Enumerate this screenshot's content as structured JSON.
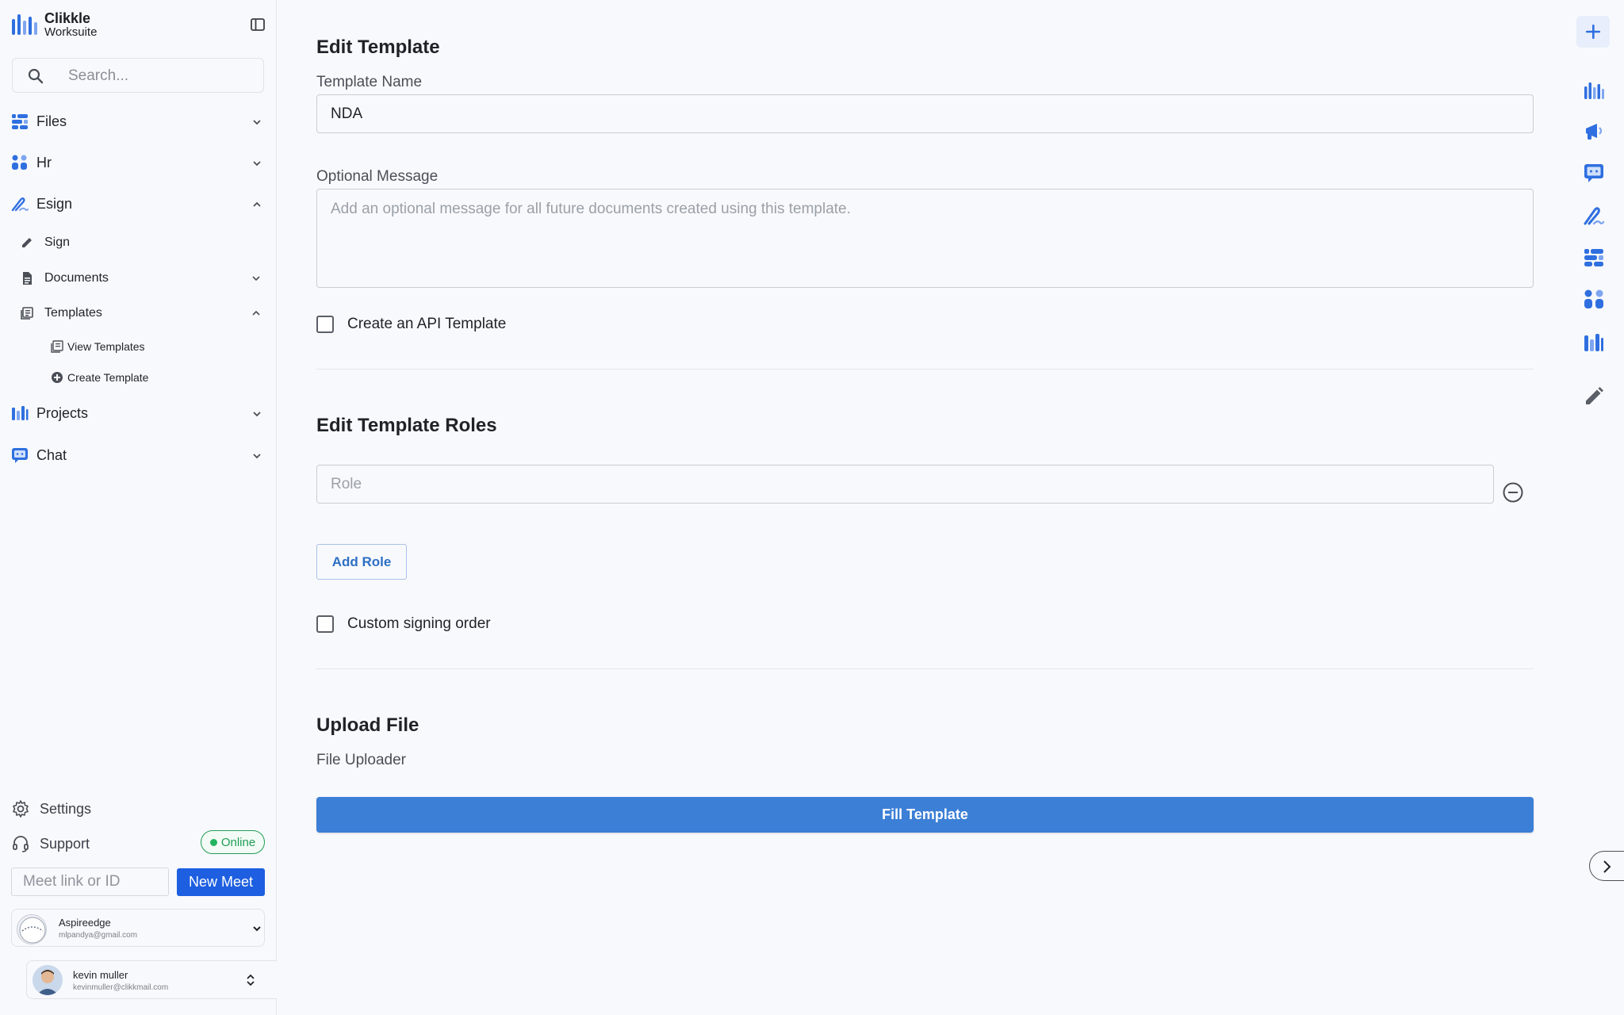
{
  "brand": {
    "line1": "Clikkle",
    "line2": "Worksuite",
    "accent": "#2563eb"
  },
  "search": {
    "placeholder": "Search..."
  },
  "sidebar": {
    "nav": {
      "files": "Files",
      "hr": "Hr",
      "esign": "Esign",
      "sign": "Sign",
      "documents": "Documents",
      "templates": "Templates",
      "view_templates": "View Templates",
      "create_template": "Create Template",
      "projects": "Projects",
      "chat": "Chat"
    },
    "settings": "Settings",
    "support": "Support",
    "status": "Online",
    "meet_placeholder": "Meet link or ID",
    "new_meet": "New Meet",
    "org": {
      "name": "Aspireedge",
      "email": "mlpandya@gmail.com"
    },
    "user": {
      "name": "kevin muller",
      "email": "kevinmuller@clikkmail.com"
    }
  },
  "form": {
    "title": "Edit Template",
    "template_name_label": "Template Name",
    "template_name_value": "NDA",
    "optional_message_label": "Optional Message",
    "optional_message_placeholder": "Add an optional message for all future documents created using this template.",
    "api_template_label": "Create an API Template",
    "roles_title": "Edit Template Roles",
    "role_placeholder": "Role",
    "add_role": "Add Role",
    "custom_order_label": "Custom signing order",
    "upload_title": "Upload File",
    "uploader_label": "File Uploader",
    "fill_button": "Fill Template"
  }
}
